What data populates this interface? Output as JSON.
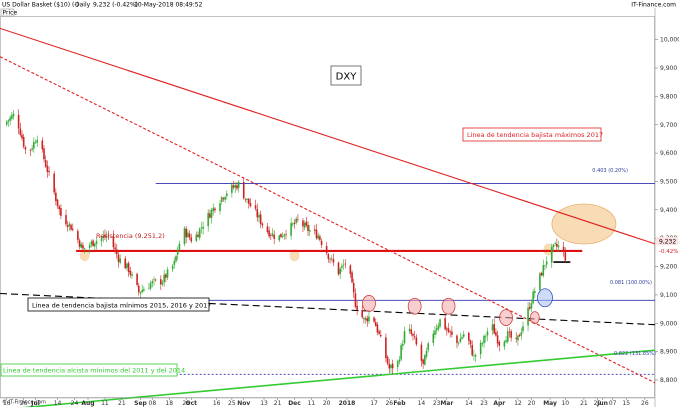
{
  "header": {
    "title": "US Dollar Basket ($10) (-)",
    "period": "Daily",
    "quote": "9,232 (-0.42%)",
    "timestamp": "10-May-2018 08:49:52",
    "source": "IT-Finance.com",
    "price_label": "Price"
  },
  "watermark": "DXY",
  "footer": "© IT-Finance.com",
  "chart_data": {
    "type": "candlestick",
    "instrument": "DXY",
    "y_axis": {
      "ticks": [
        {
          "value": 10000,
          "label": "10,000"
        },
        {
          "value": 9900,
          "label": "9,900"
        },
        {
          "value": 9800,
          "label": "9,800"
        },
        {
          "value": 9700,
          "label": "9,700"
        },
        {
          "value": 9600,
          "label": "9,600"
        },
        {
          "value": 9500,
          "label": "9,500"
        },
        {
          "value": 9400,
          "label": "9,400"
        },
        {
          "value": 9300,
          "label": "9,300"
        },
        {
          "value": 9200,
          "label": "9,200"
        },
        {
          "value": 9100,
          "label": "9,100"
        },
        {
          "value": 9000,
          "label": "9,000"
        },
        {
          "value": 8900,
          "label": "8,900"
        },
        {
          "value": 8800,
          "label": "8,800"
        }
      ],
      "range": [
        8740,
        10080
      ]
    },
    "x_axis": {
      "ticks": [
        {
          "label": "16",
          "day": 0,
          "bold": false
        },
        {
          "label": "26",
          "day": 10,
          "bold": false
        },
        {
          "label": "Jul",
          "day": 17,
          "bold": true
        },
        {
          "label": "14",
          "day": 30,
          "bold": false
        },
        {
          "label": "24",
          "day": 40,
          "bold": false
        },
        {
          "label": "Aug",
          "day": 48,
          "bold": true
        },
        {
          "label": "11",
          "day": 58,
          "bold": false
        },
        {
          "label": "21",
          "day": 68,
          "bold": false
        },
        {
          "label": "Sep",
          "day": 79,
          "bold": true
        },
        {
          "label": "08",
          "day": 86,
          "bold": false
        },
        {
          "label": "18",
          "day": 96,
          "bold": false
        },
        {
          "label": "28",
          "day": 106,
          "bold": false
        },
        {
          "label": "Oct",
          "day": 109,
          "bold": true
        },
        {
          "label": "16",
          "day": 124,
          "bold": false
        },
        {
          "label": "25",
          "day": 133,
          "bold": false
        },
        {
          "label": "Nov",
          "day": 140,
          "bold": true
        },
        {
          "label": "13",
          "day": 152,
          "bold": false
        },
        {
          "label": "21",
          "day": 160,
          "bold": false
        },
        {
          "label": "Dec",
          "day": 170,
          "bold": true
        },
        {
          "label": "11",
          "day": 180,
          "bold": false
        },
        {
          "label": "20",
          "day": 189,
          "bold": false
        },
        {
          "label": "2018",
          "day": 201,
          "bold": true
        },
        {
          "label": "17",
          "day": 217,
          "bold": false
        },
        {
          "label": "26",
          "day": 226,
          "bold": false
        },
        {
          "label": "Feb",
          "day": 232,
          "bold": true
        },
        {
          "label": "14",
          "day": 245,
          "bold": false
        },
        {
          "label": "23",
          "day": 254,
          "bold": false
        },
        {
          "label": "Mar",
          "day": 260,
          "bold": true
        },
        {
          "label": "14",
          "day": 273,
          "bold": false
        },
        {
          "label": "23",
          "day": 282,
          "bold": false
        },
        {
          "label": "Apr",
          "day": 291,
          "bold": true
        },
        {
          "label": "12",
          "day": 302,
          "bold": false
        },
        {
          "label": "20",
          "day": 310,
          "bold": false
        },
        {
          "label": "May",
          "day": 321,
          "bold": true
        },
        {
          "label": "10",
          "day": 330,
          "bold": false
        },
        {
          "label": "21",
          "day": 341,
          "bold": false
        },
        {
          "label": "29",
          "day": 349,
          "bold": false
        },
        {
          "label": "Jun",
          "day": 352,
          "bold": true
        },
        {
          "label": "07",
          "day": 358,
          "bold": false
        },
        {
          "label": "15",
          "day": 366,
          "bold": false
        },
        {
          "label": "26",
          "day": 377,
          "bold": false
        }
      ],
      "range": [
        -4,
        383
      ]
    },
    "anchors": [
      {
        "day": -2,
        "close": 9700
      },
      {
        "day": 5,
        "close": 9740
      },
      {
        "day": 12,
        "close": 9590
      },
      {
        "day": 18,
        "close": 9660
      },
      {
        "day": 25,
        "close": 9520
      },
      {
        "day": 32,
        "close": 9380
      },
      {
        "day": 38,
        "close": 9340
      },
      {
        "day": 45,
        "close": 9260
      },
      {
        "day": 52,
        "close": 9290
      },
      {
        "day": 60,
        "close": 9310
      },
      {
        "day": 66,
        "close": 9230
      },
      {
        "day": 72,
        "close": 9190
      },
      {
        "day": 78,
        "close": 9110
      },
      {
        "day": 85,
        "close": 9140
      },
      {
        "day": 92,
        "close": 9150
      },
      {
        "day": 99,
        "close": 9210
      },
      {
        "day": 104,
        "close": 9330
      },
      {
        "day": 110,
        "close": 9290
      },
      {
        "day": 118,
        "close": 9370
      },
      {
        "day": 125,
        "close": 9430
      },
      {
        "day": 131,
        "close": 9470
      },
      {
        "day": 137,
        "close": 9490
      },
      {
        "day": 141,
        "close": 9440
      },
      {
        "day": 147,
        "close": 9390
      },
      {
        "day": 153,
        "close": 9330
      },
      {
        "day": 160,
        "close": 9300
      },
      {
        "day": 166,
        "close": 9330
      },
      {
        "day": 172,
        "close": 9360
      },
      {
        "day": 178,
        "close": 9330
      },
      {
        "day": 184,
        "close": 9310
      },
      {
        "day": 190,
        "close": 9240
      },
      {
        "day": 196,
        "close": 9180
      },
      {
        "day": 201,
        "close": 9220
      },
      {
        "day": 206,
        "close": 9070
      },
      {
        "day": 211,
        "close": 9010
      },
      {
        "day": 216,
        "close": 9030
      },
      {
        "day": 221,
        "close": 8940
      },
      {
        "day": 226,
        "close": 8840
      },
      {
        "day": 231,
        "close": 8860
      },
      {
        "day": 236,
        "close": 8990
      },
      {
        "day": 241,
        "close": 8940
      },
      {
        "day": 246,
        "close": 8850
      },
      {
        "day": 251,
        "close": 8960
      },
      {
        "day": 256,
        "close": 9010
      },
      {
        "day": 261,
        "close": 8970
      },
      {
        "day": 266,
        "close": 8930
      },
      {
        "day": 271,
        "close": 8970
      },
      {
        "day": 276,
        "close": 8880
      },
      {
        "day": 281,
        "close": 8930
      },
      {
        "day": 286,
        "close": 9000
      },
      {
        "day": 291,
        "close": 8930
      },
      {
        "day": 296,
        "close": 8960
      },
      {
        "day": 301,
        "close": 8930
      },
      {
        "day": 306,
        "close": 9010
      },
      {
        "day": 311,
        "close": 9100
      },
      {
        "day": 316,
        "close": 9180
      },
      {
        "day": 320,
        "close": 9240
      },
      {
        "day": 324,
        "close": 9270
      },
      {
        "day": 327,
        "close": 9270
      },
      {
        "day": 330,
        "close": 9232
      }
    ],
    "levels": [
      {
        "name": "fib-50",
        "price": 9493,
        "label": "0.403 (0.20%)"
      },
      {
        "name": "fib-100",
        "price": 9081,
        "label": "0.081 (100.00%)"
      },
      {
        "name": "fib-low",
        "price": 8820,
        "label": "0.822 (131.85%)"
      }
    ],
    "resistance": {
      "price": 9255,
      "label": "Resistencia (9.251,2)"
    },
    "current_price": {
      "label": "9,232",
      "change": "-0.42%"
    },
    "trendlines": [
      {
        "name": "maximos-2017",
        "label": "Linea de tendencia bajista máximos 2017",
        "color": "#e02020",
        "style": "solid",
        "p1": [
          -4,
          10040
        ],
        "p2": [
          383,
          9280
        ]
      },
      {
        "name": "red-dotted",
        "color": "#e02020",
        "style": "dotted",
        "p1": [
          -4,
          9940
        ],
        "p2": [
          383,
          8790
        ]
      },
      {
        "name": "minimos-2015-2017",
        "label": "Linea de tendencia bajista mínimos 2015, 2016 y 2017",
        "color": "#000000",
        "style": "dashed",
        "p1": [
          -4,
          9105
        ],
        "p2": [
          383,
          8995
        ]
      },
      {
        "name": "alcista-2011-2014",
        "label": "Linea de tendencia alcista mínimos del 2011 y del 2014",
        "color": "#33cc33",
        "style": "solid",
        "p1": [
          -4,
          8695
        ],
        "p2": [
          383,
          8905
        ]
      }
    ],
    "ellipses": [
      {
        "name": "pivot-aug",
        "day": 46,
        "price": 9240,
        "rx": 5,
        "ry": 6,
        "fill": "#f5d09c",
        "stroke": "none"
      },
      {
        "name": "pivot-dec",
        "day": 170,
        "price": 9240,
        "rx": 5,
        "ry": 6,
        "fill": "#f5d09c",
        "stroke": "none"
      },
      {
        "name": "pivot-apr",
        "day": 320,
        "price": 9260,
        "rx": 5,
        "ry": 6,
        "fill": "#f5d09c",
        "stroke": "none"
      },
      {
        "name": "target-zone",
        "day": 341,
        "price": 9350,
        "rx": 32,
        "ry": 20,
        "fill": "#f5d09c",
        "stroke": "#e8b070"
      },
      {
        "name": "touch-1",
        "day": 214,
        "price": 9070,
        "rx": 6.5,
        "ry": 8,
        "fill": "#f4a6a6",
        "stroke": "#d04040"
      },
      {
        "name": "touch-2",
        "day": 241,
        "price": 9060,
        "rx": 6.5,
        "ry": 8,
        "fill": "#f4a6a6",
        "stroke": "#d04040"
      },
      {
        "name": "touch-3",
        "day": 261,
        "price": 9060,
        "rx": 6.5,
        "ry": 8,
        "fill": "#f4a6a6",
        "stroke": "#d04040"
      },
      {
        "name": "touch-4",
        "day": 295,
        "price": 9020,
        "rx": 6.5,
        "ry": 8,
        "fill": "#f4a6a6",
        "stroke": "#d04040"
      },
      {
        "name": "touch-5",
        "day": 312,
        "price": 9020,
        "rx": 4.5,
        "ry": 6,
        "fill": "#f4a6a6",
        "stroke": "#d04040"
      },
      {
        "name": "breakout",
        "day": 318,
        "price": 9090,
        "rx": 7.5,
        "ry": 9,
        "fill": "#a8c0f0",
        "stroke": "#3050c0"
      }
    ],
    "bullish_color": "#33aa33",
    "bearish_color": "#cc2222",
    "grid": false
  }
}
